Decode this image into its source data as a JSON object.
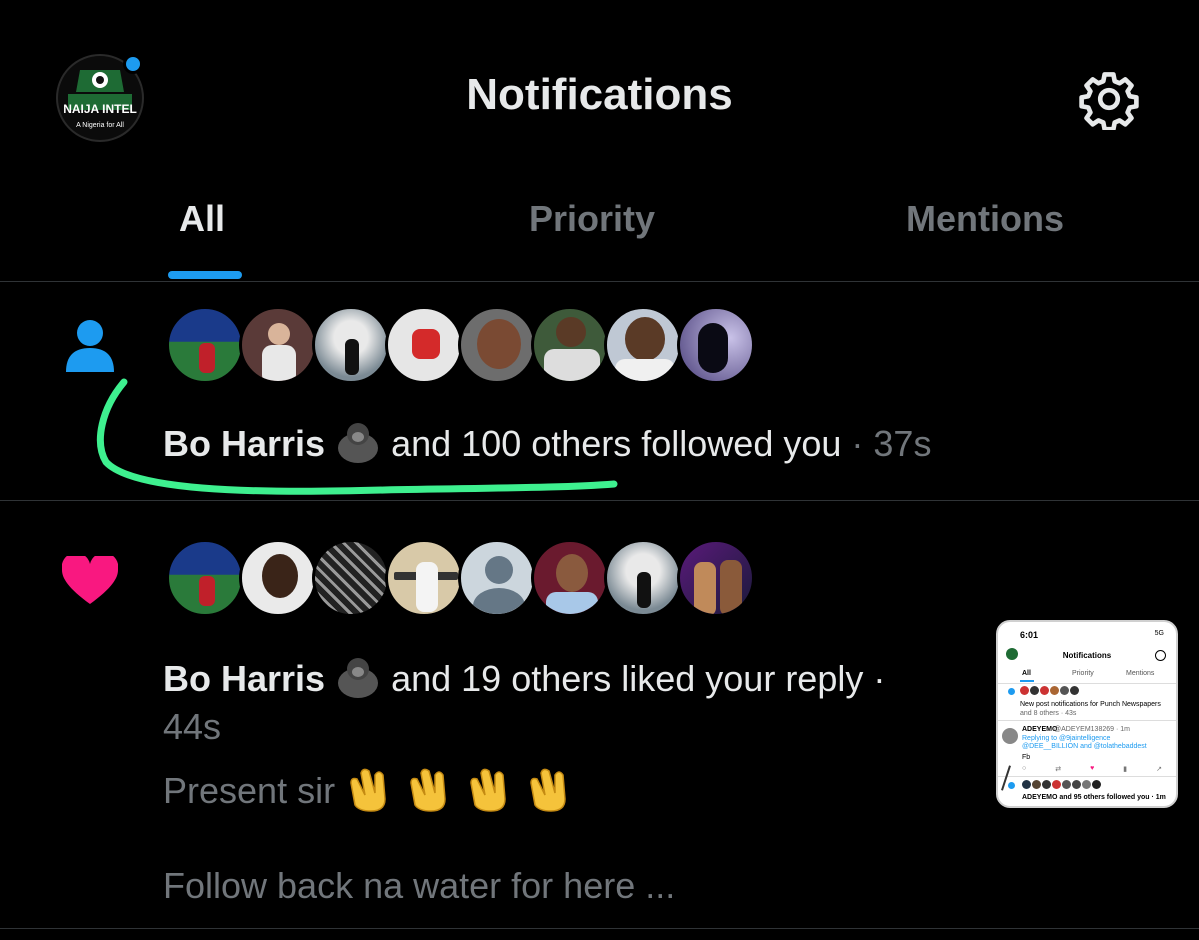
{
  "header": {
    "title": "Notifications",
    "logo_text": "NAIJA INTEL",
    "logo_subtext": "A Nigeria for All",
    "settings_icon": "gear-icon"
  },
  "tabs": [
    {
      "label": "All",
      "active": true
    },
    {
      "label": "Priority",
      "active": false
    },
    {
      "label": "Mentions",
      "active": false
    }
  ],
  "notifications": [
    {
      "type_icon": "person-icon",
      "name": "Bo Harris",
      "action": " and 100 others followed you",
      "time": "· 37s"
    },
    {
      "type_icon": "heart-icon",
      "name": "Bo Harris",
      "action": " and 19 others liked your reply ·",
      "time": "44s",
      "preview": "Present sir",
      "preview_emoji": "clapping-hands",
      "preview2": "Follow back na water for here ..."
    }
  ],
  "thumbnail": {
    "time": "6:01",
    "status": "5G",
    "title": "Notifications",
    "tabs": [
      "All",
      "Priority",
      "Mentions"
    ],
    "line1": "New post notifications for Punch Newspapers",
    "line1b": "and 8 others · 43s",
    "user": "ADEYEMO",
    "handle": "@ADEYEM138269 · 1m",
    "reply": "Replying to @9jaintelligence @DEE__BILLION and @tolathebaddest",
    "reply2": "Fb",
    "bottom": "ADEYEMO and 95 others followed you · 1m"
  },
  "colors": {
    "accent": "#1d9bf0",
    "heart": "#f91880",
    "muted": "#71767b",
    "annotation": "#3ef08f"
  }
}
